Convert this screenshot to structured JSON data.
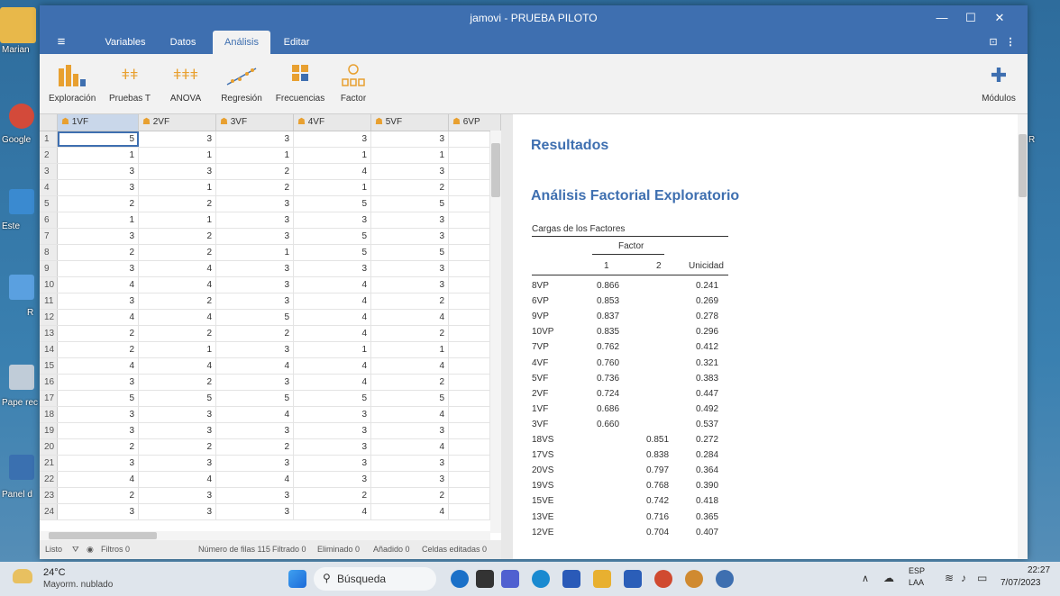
{
  "window": {
    "title": "jamovi - PRUEBA PILOTO"
  },
  "menu": {
    "hamburger": "≡",
    "tabs": [
      "Variables",
      "Datos",
      "Análisis",
      "Editar"
    ],
    "more": "⋮"
  },
  "toolbar": {
    "items": [
      "Exploración",
      "Pruebas T",
      "ANOVA",
      "Regresión",
      "Frecuencias",
      "Factor"
    ],
    "modules": "Módulos"
  },
  "grid": {
    "columns": [
      "1VF",
      "2VF",
      "3VF",
      "4VF",
      "5VF",
      "6VP"
    ],
    "rows": [
      [
        "1",
        "5",
        "3",
        "3",
        "3",
        "3"
      ],
      [
        "2",
        "1",
        "1",
        "1",
        "1",
        "1"
      ],
      [
        "3",
        "3",
        "3",
        "2",
        "4",
        "3"
      ],
      [
        "4",
        "3",
        "1",
        "2",
        "1",
        "2"
      ],
      [
        "5",
        "2",
        "2",
        "3",
        "5",
        "5"
      ],
      [
        "6",
        "1",
        "1",
        "3",
        "3",
        "3"
      ],
      [
        "7",
        "3",
        "2",
        "3",
        "5",
        "3"
      ],
      [
        "8",
        "2",
        "2",
        "1",
        "5",
        "5"
      ],
      [
        "9",
        "3",
        "4",
        "3",
        "3",
        "3"
      ],
      [
        "10",
        "4",
        "4",
        "3",
        "4",
        "3"
      ],
      [
        "11",
        "3",
        "2",
        "3",
        "4",
        "2"
      ],
      [
        "12",
        "4",
        "4",
        "5",
        "4",
        "4"
      ],
      [
        "13",
        "2",
        "2",
        "2",
        "4",
        "2"
      ],
      [
        "14",
        "2",
        "1",
        "3",
        "1",
        "1"
      ],
      [
        "15",
        "4",
        "4",
        "4",
        "4",
        "4"
      ],
      [
        "16",
        "3",
        "2",
        "3",
        "4",
        "2"
      ],
      [
        "17",
        "5",
        "5",
        "5",
        "5",
        "5"
      ],
      [
        "18",
        "3",
        "3",
        "4",
        "3",
        "4"
      ],
      [
        "19",
        "3",
        "3",
        "3",
        "3",
        "3"
      ],
      [
        "20",
        "2",
        "2",
        "2",
        "3",
        "4"
      ],
      [
        "21",
        "3",
        "3",
        "3",
        "3",
        "3"
      ],
      [
        "22",
        "4",
        "4",
        "4",
        "3",
        "3"
      ],
      [
        "23",
        "2",
        "3",
        "3",
        "2",
        "2"
      ],
      [
        "24",
        "3",
        "3",
        "3",
        "4",
        "4"
      ]
    ]
  },
  "status": {
    "ready": "Listo",
    "filters": "Filtros 0",
    "rows": "Número de filas 115",
    "filtered": "Filtrado 0",
    "deleted": "Eliminado 0",
    "added": "Añadido 0",
    "edited": "Celdas editadas 0"
  },
  "results": {
    "heading": "Resultados",
    "analysis_title": "Análisis Factorial Exploratorio",
    "table_title": "Cargas de los Factores",
    "factor_header": "Factor",
    "col1": "1",
    "col2": "2",
    "uniqueness": "Unicidad",
    "rows": [
      [
        "8VP",
        "0.866",
        "",
        "0.241"
      ],
      [
        "6VP",
        "0.853",
        "",
        "0.269"
      ],
      [
        "9VP",
        "0.837",
        "",
        "0.278"
      ],
      [
        "10VP",
        "0.835",
        "",
        "0.296"
      ],
      [
        "7VP",
        "0.762",
        "",
        "0.412"
      ],
      [
        "4VF",
        "0.760",
        "",
        "0.321"
      ],
      [
        "5VF",
        "0.736",
        "",
        "0.383"
      ],
      [
        "2VF",
        "0.724",
        "",
        "0.447"
      ],
      [
        "1VF",
        "0.686",
        "",
        "0.492"
      ],
      [
        "3VF",
        "0.660",
        "",
        "0.537"
      ],
      [
        "18VS",
        "",
        "0.851",
        "0.272"
      ],
      [
        "17VS",
        "",
        "0.838",
        "0.284"
      ],
      [
        "20VS",
        "",
        "0.797",
        "0.364"
      ],
      [
        "19VS",
        "",
        "0.768",
        "0.390"
      ],
      [
        "15VE",
        "",
        "0.742",
        "0.418"
      ],
      [
        "13VE",
        "",
        "0.716",
        "0.365"
      ],
      [
        "12VE",
        "",
        "0.704",
        "0.407"
      ]
    ]
  },
  "taskbar": {
    "weather_temp": "24°C",
    "weather_desc": "Mayorm. nublado",
    "search": "Búsqueda",
    "lang1": "ESP",
    "lang2": "LAA",
    "time": "22:27",
    "date": "7/07/2023"
  },
  "desktop": {
    "labels": [
      "Marian",
      "Google",
      "Este",
      "R",
      "Pape rec",
      "Panel d",
      "R"
    ]
  }
}
